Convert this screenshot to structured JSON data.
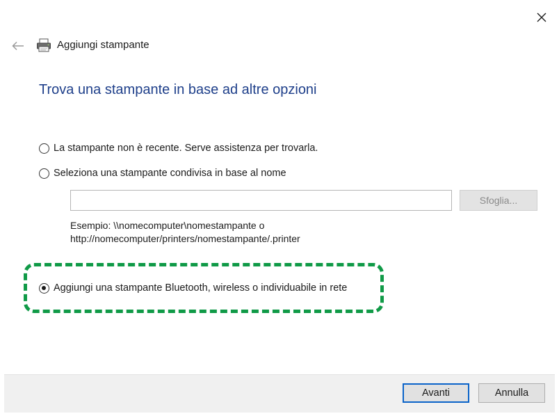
{
  "window": {
    "title": "Aggiungi stampante",
    "icons": {
      "close": "close-icon",
      "back": "back-arrow-icon",
      "app": "printer-icon"
    }
  },
  "page": {
    "title": "Trova una stampante in base ad altre opzioni"
  },
  "options": [
    {
      "label": "La stampante non è recente. Serve assistenza per trovarla.",
      "selected": false
    },
    {
      "label": "Seleziona una stampante condivisa in base al nome",
      "selected": false
    },
    {
      "label": "Aggiungi una stampante Bluetooth, wireless o individuabile in rete",
      "selected": true
    }
  ],
  "shared_printer": {
    "input_value": "",
    "browse_label": "Sfoglia...",
    "example_line1": "Esempio: \\\\nomecomputer\\nomestampante o",
    "example_line2": "http://nomecomputer/printers/nomestampante/.printer"
  },
  "footer": {
    "next_label": "Avanti",
    "cancel_label": "Annulla"
  },
  "colors": {
    "title_blue": "#1e3f8a",
    "highlight_green": "#109a47",
    "focus_blue": "#0a63c9"
  }
}
